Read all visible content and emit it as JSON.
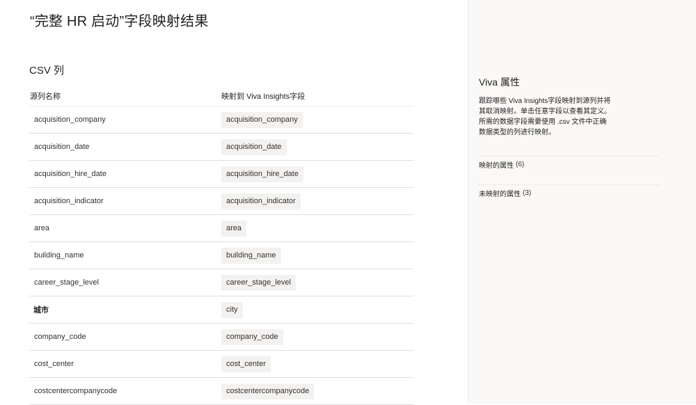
{
  "page": {
    "title": "“完整 HR 启动”字段映射结果"
  },
  "main": {
    "section_title": "CSV 列",
    "columns": {
      "source": "源列名称",
      "target": "映射到 Viva Insights字段"
    },
    "rows": [
      {
        "source": "acquisition_company",
        "target": "acquisition_company"
      },
      {
        "source": "acquisition_date",
        "target": "acquisition_date"
      },
      {
        "source": "acquisition_hire_date",
        "target": "acquisition_hire_date"
      },
      {
        "source": "acquisition_indicator",
        "target": "acquisition_indicator"
      },
      {
        "source": "area",
        "target": "area"
      },
      {
        "source": "building_name",
        "target": "building_name"
      },
      {
        "source": "career_stage_level",
        "target": "career_stage_level"
      },
      {
        "source": "城市",
        "target": "city"
      },
      {
        "source": "company_code",
        "target": "company_code"
      },
      {
        "source": "cost_center",
        "target": "cost_center"
      },
      {
        "source": "costcentercompanycode",
        "target": "costcentercompanycode"
      }
    ]
  },
  "side_panel": {
    "title": "Viva 属性",
    "description": "跟踪哪些 Viva Insights字段映射到源列并将其取消映射。单击任意字段以查看其定义。所需的数据字段需要使用 .csv 文件中正确数据类型的列进行映射。",
    "mapped": {
      "label": "映射的属性",
      "count": "(6)"
    },
    "unmapped": {
      "label": "未映射的属性",
      "count": "(3)"
    }
  }
}
